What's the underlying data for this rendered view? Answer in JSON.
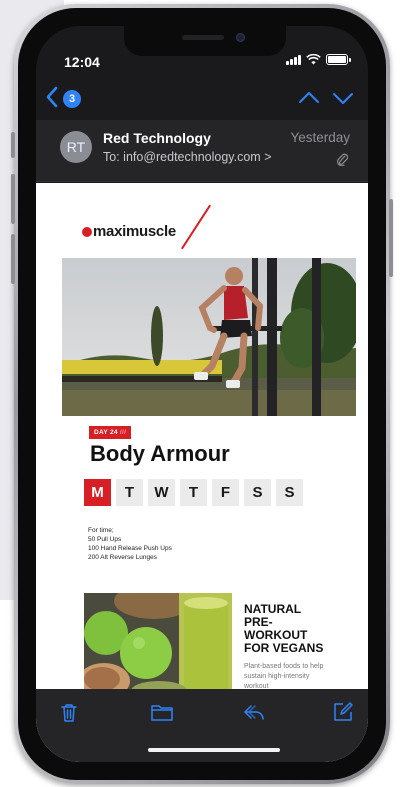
{
  "status_bar": {
    "time": "12:04"
  },
  "nav": {
    "back_count": "3"
  },
  "header": {
    "avatar_initials": "RT",
    "sender": "Red Technology",
    "to_label": "To:",
    "to_address": "info@redtechnology.com",
    "to_chevron": ">",
    "date": "Yesterday"
  },
  "email": {
    "logo_text": "maximuscle",
    "day_badge": "DAY 24",
    "day_badge_suffix": "///",
    "title": "Body Armour",
    "days": [
      "M",
      "T",
      "W",
      "T",
      "F",
      "S",
      "S"
    ],
    "active_day_index": 0,
    "workout_lines": [
      "For time;",
      "50 Pull Ups",
      "100 Hand Release Push Ups",
      "200 Alt Reverse Lunges"
    ],
    "promo_title_lines": [
      "NATURAL",
      "PRE-",
      "WORKOUT",
      "FOR VEGANS"
    ],
    "promo_sub_lines": [
      "Plant-based foods to help",
      "sustain high-intensity",
      "workout"
    ]
  },
  "toolbar": {
    "items": [
      "trash-icon",
      "folder-icon",
      "reply-icon",
      "compose-icon"
    ]
  },
  "colors": {
    "accent": "#2f83f7",
    "brand_red": "#d71f26",
    "toolbar_bg": "#252528"
  }
}
